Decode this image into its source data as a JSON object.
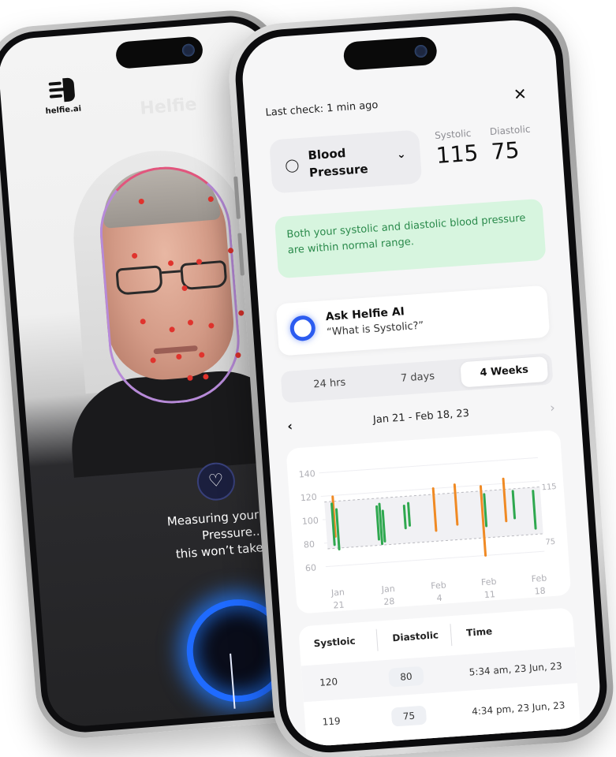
{
  "back_phone": {
    "brand": "helfie.ai",
    "ghost_brand": "Helfie",
    "measuring_lines": [
      "Measuring your Blood",
      "Pressure...",
      "this won’t take long"
    ],
    "heart_icon": "heart-outline-icon"
  },
  "front_phone": {
    "last_check": "Last check: 1 min ago",
    "close_label": "✕",
    "metric": {
      "icon": "blood-drop-icon",
      "label": "Blood Pressure",
      "chevron": "⌄"
    },
    "systolic": {
      "label": "Systolic",
      "value": "115"
    },
    "diastolic": {
      "label": "Diastolic",
      "value": "75"
    },
    "status_message": "Both your systolic and diastolic blood pressure are within normal range.",
    "ask": {
      "title": "Ask Helfie AI",
      "question": "“What is Systolic?”"
    },
    "tabs": [
      "24 hrs",
      "7 days",
      "4 Weeks"
    ],
    "active_tab": "4 Weeks",
    "date_range": "Jan 21 - Feb 18, 23",
    "prev_label": "‹",
    "next_label": "›",
    "table": {
      "headers": [
        "Systloic",
        "Diastolic",
        "Time"
      ],
      "rows": [
        {
          "systolic": "120",
          "diastolic": "80",
          "time": "5:34 am, 23 Jun, 23"
        },
        {
          "systolic": "119",
          "diastolic": "75",
          "time": "4:34 pm, 23 Jun, 23"
        }
      ]
    }
  },
  "colors": {
    "accent_blue": "#2c5cf0",
    "green": "#2fa84f",
    "orange": "#f08a24",
    "status_bg": "#d7f5df"
  },
  "chart_data": {
    "type": "bar",
    "y_ticks": [
      140,
      120,
      100,
      80,
      60
    ],
    "ylim": [
      55,
      145
    ],
    "x_ticks": [
      {
        "line1": "Jan",
        "line2": "21",
        "x": 0
      },
      {
        "line1": "Jan",
        "line2": "28",
        "x": 7
      },
      {
        "line1": "Feb",
        "line2": "4",
        "x": 14
      },
      {
        "line1": "Feb",
        "line2": "11",
        "x": 21
      },
      {
        "line1": "Feb",
        "line2": "18",
        "x": 28
      }
    ],
    "xlim": [
      -1,
      29
    ],
    "reference_labels": {
      "systolic": "115",
      "diastolic": "75"
    },
    "series": [
      {
        "color": "orange",
        "ranges": [
          [
            0.2,
            85,
            119
          ]
        ]
      },
      {
        "color": "green",
        "ranges": [
          [
            0.0,
            78,
            113
          ],
          [
            0.6,
            74,
            108
          ],
          [
            6.2,
            80,
            108
          ],
          [
            6.6,
            76,
            110
          ],
          [
            7.0,
            78,
            104
          ]
        ]
      },
      {
        "color": "green",
        "ranges": [
          [
            10.0,
            88,
            107
          ],
          [
            10.6,
            90,
            109
          ]
        ]
      },
      {
        "color": "orange",
        "ranges": [
          [
            14.2,
            84,
            120
          ]
        ]
      },
      {
        "color": "orange",
        "ranges": [
          [
            17.2,
            88,
            122
          ]
        ]
      },
      {
        "color": "orange",
        "ranges": [
          [
            20.8,
            60,
            119
          ]
        ]
      },
      {
        "color": "green",
        "ranges": [
          [
            21.2,
            85,
            112
          ]
        ]
      },
      {
        "color": "orange",
        "ranges": [
          [
            24.0,
            88,
            124
          ]
        ]
      },
      {
        "color": "green",
        "ranges": [
          [
            25.2,
            90,
            113
          ]
        ]
      },
      {
        "color": "green",
        "ranges": [
          [
            28.0,
            80,
            112
          ]
        ]
      }
    ]
  }
}
